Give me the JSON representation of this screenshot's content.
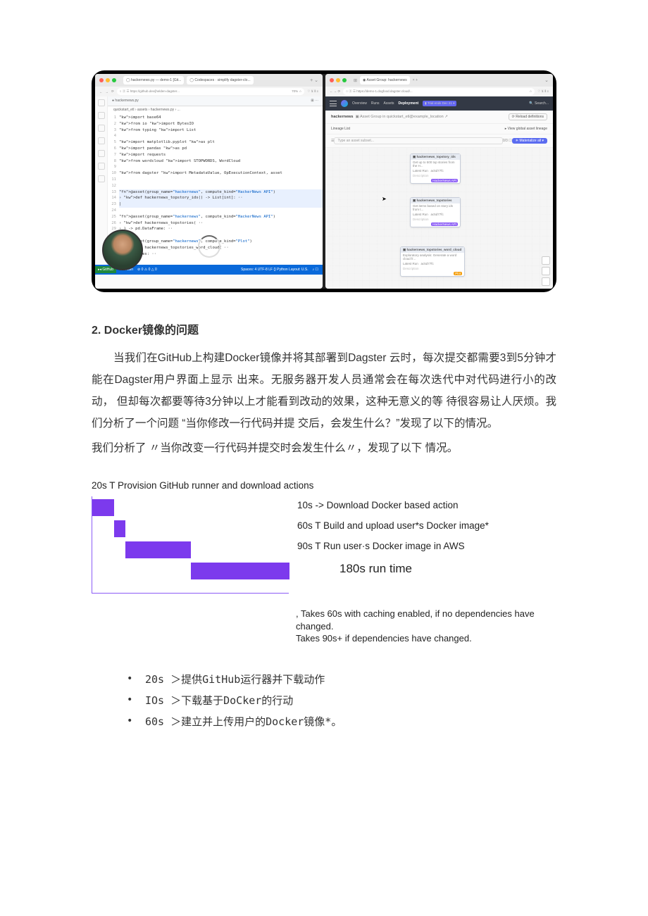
{
  "screenshot": {
    "left": {
      "tabs": [
        "hackernews.py — demo-1 [Git...",
        "Codespaces · simplify dagster-clo..."
      ],
      "url": "https://github.dev/jhelden-dagster...",
      "file_tab": "hackernews.py",
      "breadcrumb": "quickstart_etl › assets › hackernews.py › ...",
      "code_lines": [
        {
          "n": "1",
          "t": "import base64",
          "cls": ""
        },
        {
          "n": "2",
          "t": "from io import BytesIO",
          "cls": ""
        },
        {
          "n": "3",
          "t": "from typing import List",
          "cls": ""
        },
        {
          "n": "4",
          "t": "",
          "cls": ""
        },
        {
          "n": "5",
          "t": "import matplotlib.pyplot as plt",
          "cls": ""
        },
        {
          "n": "6",
          "t": "import pandas as pd",
          "cls": ""
        },
        {
          "n": "7",
          "t": "import requests",
          "cls": ""
        },
        {
          "n": "8",
          "t": "from wordcloud import STOPWORDS, WordCloud",
          "cls": ""
        },
        {
          "n": "9",
          "t": "",
          "cls": ""
        },
        {
          "n": "10",
          "t": "from dagster import MetadataValue, OpExecutionContext, asset",
          "cls": ""
        },
        {
          "n": "11",
          "t": "",
          "cls": ""
        },
        {
          "n": "12",
          "t": "",
          "cls": ""
        },
        {
          "n": "13",
          "t": "@asset(group_name=\"hackernews\", compute_kind=\"HackerNews API\")",
          "cls": "hl"
        },
        {
          "n": "14",
          "t": "› def hackernews_topstory_ids() -> List[int]: ··",
          "cls": "hl"
        },
        {
          "n": "23",
          "t": "|",
          "cls": "hl"
        },
        {
          "n": "24",
          "t": "",
          "cls": ""
        },
        {
          "n": "25",
          "t": "@asset(group_name=\"hackernews\", compute_kind=\"HackerNews API\")",
          "cls": ""
        },
        {
          "n": "26",
          "t": "› def hackernews_topstories( ··",
          "cls": ""
        },
        {
          "n": "29",
          "t": "› ) -> pd.DataFrame: ··",
          "cls": ""
        },
        {
          "n": "55",
          "t": "",
          "cls": ""
        },
        {
          "n": "56",
          "t": "@asset(group_name=\"hackernews\", compute_kind=\"Plot\")",
          "cls": ""
        },
        {
          "n": "57",
          "t": "› def hackernews_topstories_word_cloud( ··",
          "cls": ""
        },
        {
          "n": "59",
          "t": "› ) -> bytes: ··",
          "cls": ""
        },
        {
          "n": "60",
          "t": "",
          "cls": ""
        }
      ],
      "status": {
        "branch": "main",
        "errors": "0",
        "warnings": "0",
        "info": "Spaces: 4   UTF-8   LF   {} Python   Layout: U.S."
      }
    },
    "right": {
      "tab": "Asset Group: hackernews",
      "url": "https://demo-1.dogfood.dagster.cloud/...",
      "nav": [
        "Overview",
        "Runs",
        "Assets",
        "Deployment"
      ],
      "trial": "Trial ends Dec 21",
      "search": "Search...",
      "title": "hackernews",
      "subtitle": "Asset Group in quickstart_etl@example_location",
      "reload_btn": "Reload definitions",
      "lineage": "Lineage   List",
      "view_lineage": "View global asset lineage",
      "filter_placeholder": "Type an asset subset...",
      "materialize_btn": "Materialize all",
      "nodes": [
        {
          "name": "hackernews_topstory_ids",
          "desc": "Get up to 500 top stories from the H...",
          "run": "Latest Run",
          "val": "ac5d77fc",
          "badge": "HackerNews API",
          "badge_cls": ""
        },
        {
          "name": "hackernews_topstories",
          "desc": "Get items based on story ids from t...",
          "run": "Latest Run",
          "val": "ac5d77fc",
          "badge": "HackerNews API",
          "badge_cls": ""
        },
        {
          "name": "hackernews_topstories_word_cloud",
          "desc": "Exploratory analysis: Generate a word cloud fr...",
          "run": "Latest Run",
          "val": "ac5d77fc",
          "badge": "Plot",
          "badge_cls": "orange"
        }
      ]
    }
  },
  "section": {
    "heading": "2. Docker镜像的问题",
    "p1": "当我们在GitHub上构建Docker镜像并将其部署到Dagster 云时，每次提交都需要3到5分钟才能在Dagster用户界面上显示 出来。无服务器开发人员通常会在每次迭代中对代码进行小的改动， 但却每次都要等待3分钟以上才能看到改动的效果，这种无意义的等 待很容易让人厌烦。我们分析了一个问题 “当你修改一行代码并提 交后，会发生什么？”发现了以下的情况。",
    "p2": "我们分析了 〃当你改变一行代码并提交时会发生什么〃，发现了以下 情况。"
  },
  "chart_data": {
    "type": "gantt",
    "title": "20s T Provision GitHub runner and download actions",
    "steps": [
      {
        "label": "10s -> Download Docker based action",
        "start": 20,
        "duration": 10
      },
      {
        "label": "60s T Build and upload user*s Docker image*",
        "start": 30,
        "duration": 60
      },
      {
        "label": "90s T Run user·s Docker image in AWS",
        "start": 90,
        "duration": 90
      }
    ],
    "first_bar": {
      "start": 0,
      "duration": 20
    },
    "total_label": "180s run time",
    "x_range": [
      0,
      180
    ],
    "footnote1": ", Takes 60s with caching enabled, if no dependencies have changed.",
    "footnote2": "Takes 90s+ if dependencies have changed."
  },
  "bullets": [
    "20s ＞提供GitHub运行器并下载动作",
    "IOs ＞下载基于DoCker的行动",
    "60s ＞建立并上传用户的Docker镜像*。"
  ]
}
